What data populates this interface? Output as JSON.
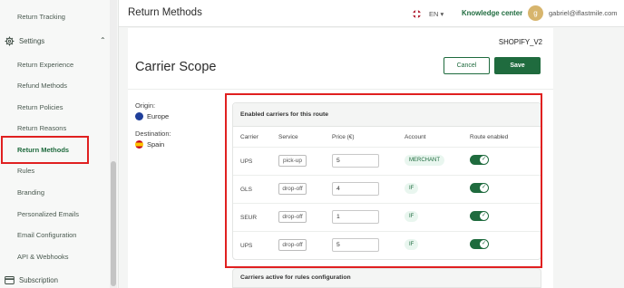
{
  "topbar": {
    "page_title": "Return Methods",
    "language": "EN ▾",
    "knowledge_center": "Knowledge center",
    "avatar_initial": "g",
    "user_email": "gabriel@iflastmile.com"
  },
  "sidebar": {
    "items": [
      {
        "label": "Return Tracking"
      },
      {
        "label": "Settings"
      },
      {
        "label": "Return Experience"
      },
      {
        "label": "Refund Methods"
      },
      {
        "label": "Return Policies"
      },
      {
        "label": "Return Reasons"
      },
      {
        "label": "Return Methods",
        "active": true
      },
      {
        "label": "Rules"
      },
      {
        "label": "Branding"
      },
      {
        "label": "Personalized Emails"
      },
      {
        "label": "Email Configuration"
      },
      {
        "label": "API & Webhooks"
      },
      {
        "label": "Subscription"
      }
    ],
    "settings_chevron": "⌃"
  },
  "main": {
    "shop": "SHOPIFY_V2",
    "title": "Carrier Scope",
    "cancel_label": "Cancel",
    "save_label": "Save",
    "origin_label": "Origin:",
    "origin_value": "Europe",
    "destination_label": "Destination:",
    "destination_value": "Spain"
  },
  "carriers": {
    "title": "Enabled carriers for this route",
    "headers": {
      "carrier": "Carrier",
      "service": "Service",
      "price": "Price (€)",
      "account": "Account",
      "route_enabled": "Route enabled"
    },
    "rows": [
      {
        "carrier": "UPS",
        "service": "pick-up",
        "price": "5",
        "account": "MERCHANT",
        "enabled": true
      },
      {
        "carrier": "GLS",
        "service": "drop-off",
        "price": "4",
        "account": "IF",
        "enabled": true
      },
      {
        "carrier": "SEUR",
        "service": "drop-off",
        "price": "1",
        "account": "IF",
        "enabled": true
      },
      {
        "carrier": "UPS",
        "service": "drop-off",
        "price": "5",
        "account": "IF",
        "enabled": true
      }
    ],
    "toggle_check": "✓"
  },
  "rules_panel": {
    "title": "Carriers active for rules configuration"
  },
  "colors": {
    "accent": "#1f6b3e",
    "highlight": "#e02020"
  }
}
